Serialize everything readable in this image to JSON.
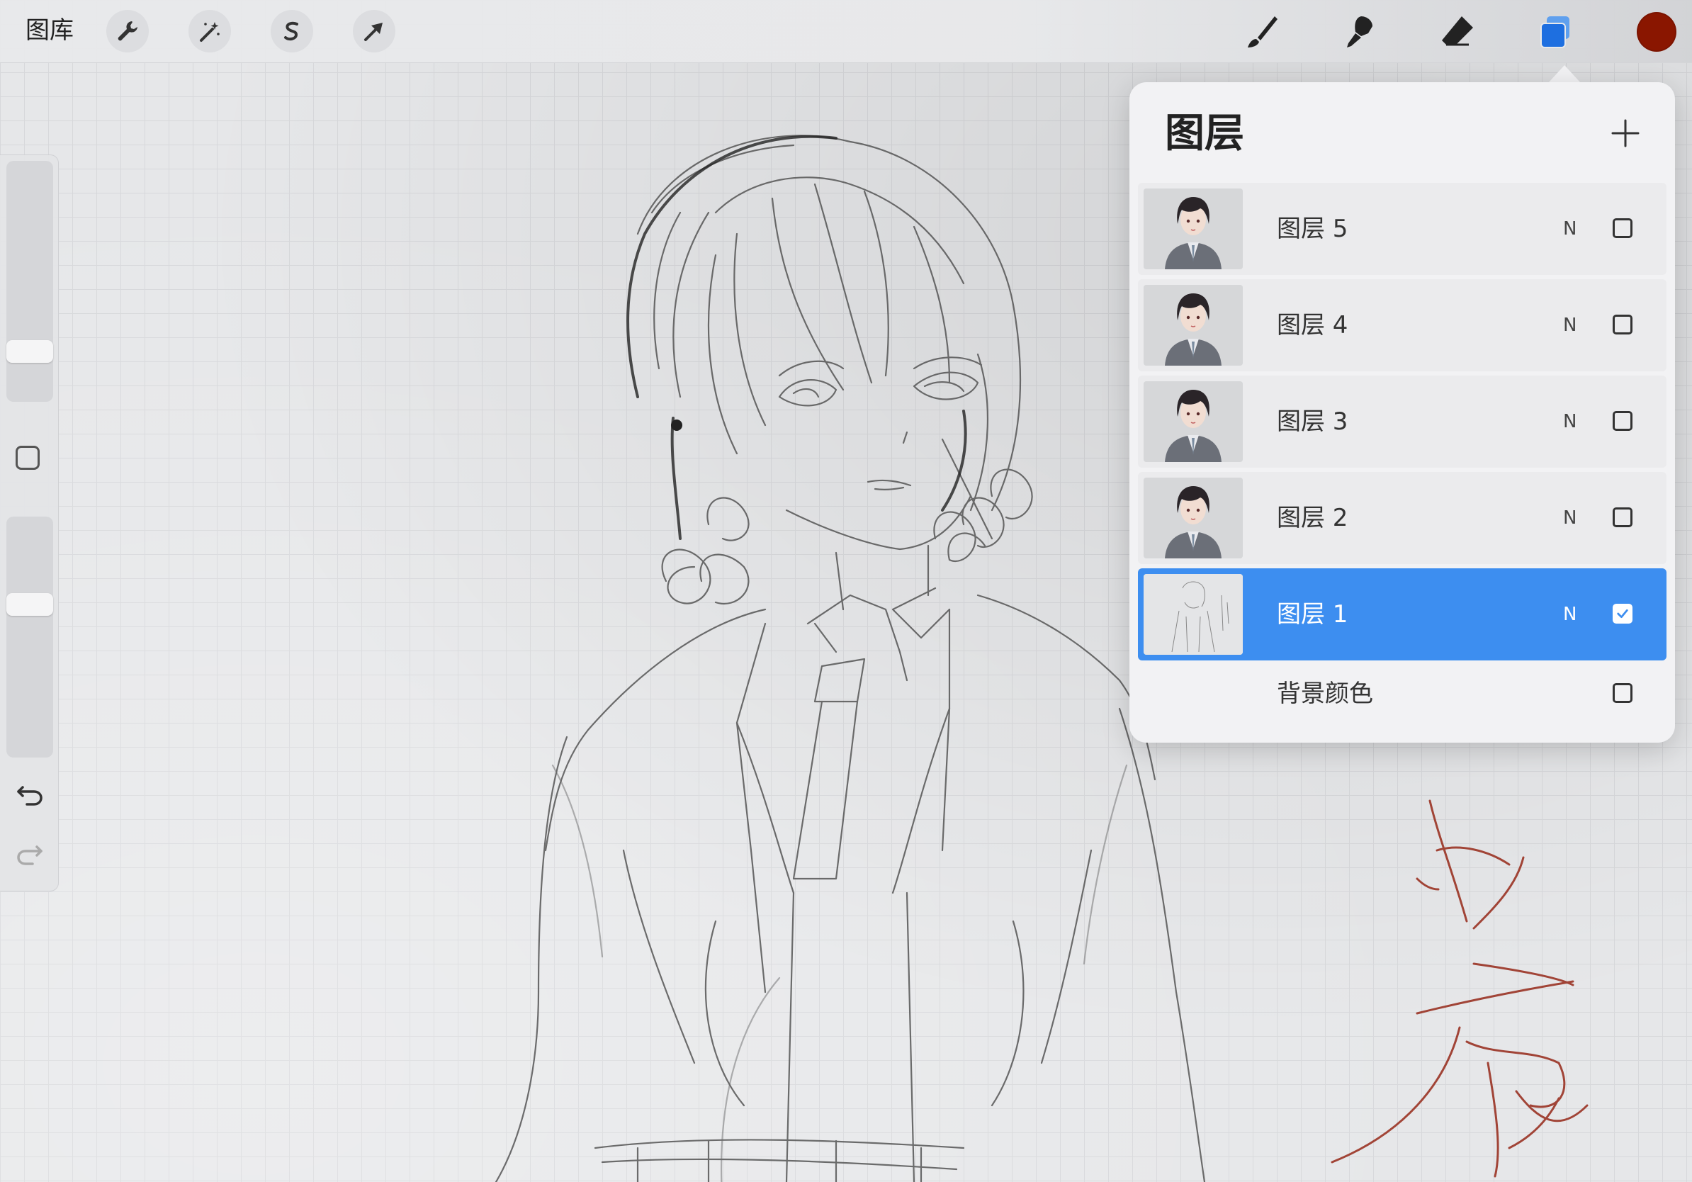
{
  "toolbar": {
    "gallery_label": "图库",
    "tools_left": [
      "wrench-icon",
      "magic-wand-icon",
      "selection-s-icon",
      "transform-arrow-icon"
    ],
    "tools_right": [
      "brush-icon",
      "smudge-icon",
      "eraser-icon",
      "layers-icon"
    ],
    "active_tool": "layers-icon",
    "current_color": "#8a1600",
    "accent_color": "#3d8ef0"
  },
  "sidebar": {
    "brush_size_level": 0.18,
    "opacity_level": 0.65,
    "controls": [
      "modify-square-icon",
      "undo-icon",
      "redo-icon"
    ]
  },
  "layers_panel": {
    "title": "图层",
    "add_icon": "plus-icon",
    "layers": [
      {
        "name": "图层 5",
        "blend": "N",
        "visible": false,
        "selected": false
      },
      {
        "name": "图层 4",
        "blend": "N",
        "visible": false,
        "selected": false
      },
      {
        "name": "图层 3",
        "blend": "N",
        "visible": false,
        "selected": false
      },
      {
        "name": "图层 2",
        "blend": "N",
        "visible": false,
        "selected": false
      },
      {
        "name": "图层 1",
        "blend": "N",
        "visible": true,
        "selected": true
      }
    ],
    "background": {
      "name": "背景颜色",
      "visible": false
    }
  }
}
